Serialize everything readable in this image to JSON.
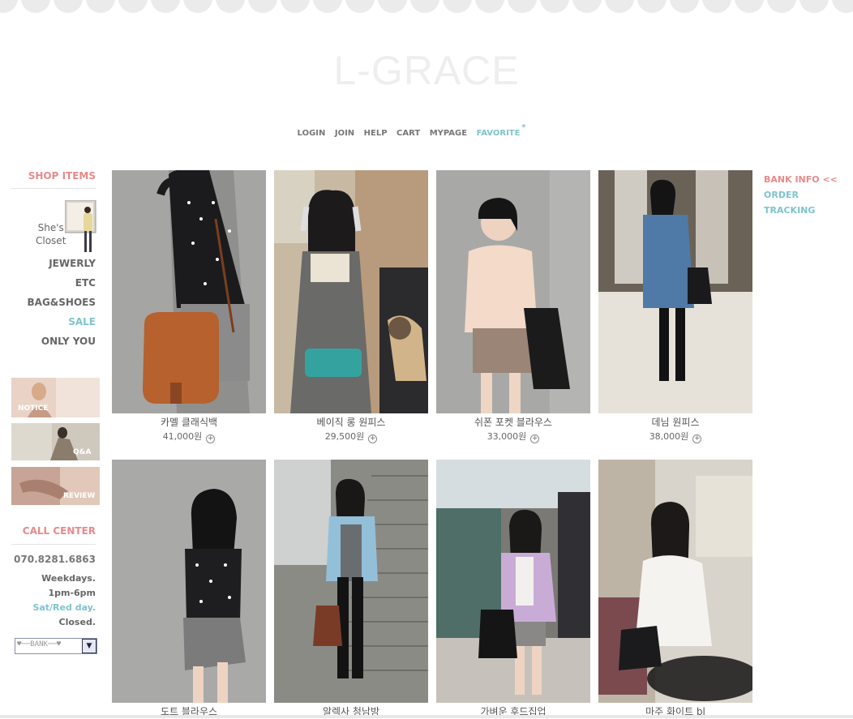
{
  "brand": {
    "logo_text": "L-GRACE"
  },
  "top_nav": [
    "LOGIN",
    "JOIN",
    "HELP",
    "CART",
    "MYPAGE"
  ],
  "favorite": {
    "label": "FAVORITE",
    "mark": "*"
  },
  "sidebar": {
    "shop_items": "SHOP ITEMS",
    "closet": [
      "She's",
      "Closet"
    ],
    "categories": [
      "JEWERLY",
      "ETC",
      "BAG&SHOES",
      "SALE",
      "ONLY YOU"
    ],
    "banners": [
      "NOTICE",
      "Q&A",
      "REVIEW"
    ]
  },
  "call_center": {
    "heading": "CALL CENTER",
    "phone": "070.8281.6863",
    "hours": [
      "Weekdays.",
      "1pm-6pm",
      "Sat/Red day.",
      "Closed."
    ],
    "bank_select": "♥──BANK──♥"
  },
  "right_nav": {
    "bank_info": "BANK INFO <<",
    "order_tracking": "ORDER TRACKING"
  },
  "products": [
    {
      "name": "카멜 클래식백",
      "price": "41,000원"
    },
    {
      "name": "베이직 롱 원피스",
      "price": "29,500원"
    },
    {
      "name": "쉬폰 포켓 블라우스",
      "price": "33,000원"
    },
    {
      "name": "데님 원피스",
      "price": "38,000원"
    },
    {
      "name": "도트 블라우스",
      "price": ""
    },
    {
      "name": "알렉사 청남방",
      "price": ""
    },
    {
      "name": "가벼운 후드집업",
      "price": ""
    },
    {
      "name": "마주 화이트 bl",
      "price": ""
    }
  ],
  "colors": {
    "pink": "#e88a8a",
    "teal": "#7ec4cc",
    "text": "#666666"
  }
}
